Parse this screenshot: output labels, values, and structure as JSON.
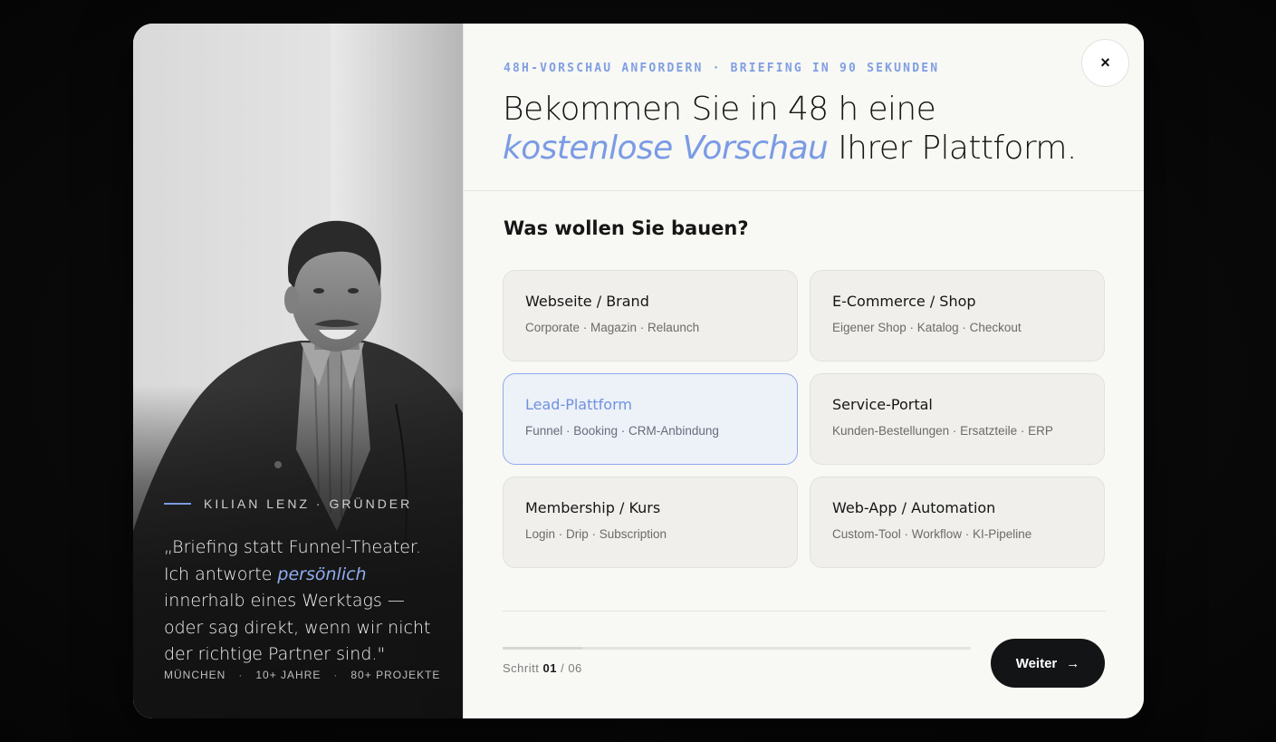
{
  "intro": {
    "eyebrow": "48H-VORSCHAU ANFORDERN · BRIEFING IN 90 SEKUNDEN",
    "headline_before": "Bekommen Sie in 48 h eine ",
    "headline_emph": "kostenlose Vorschau",
    "headline_after": " Ihrer Plattform."
  },
  "close": {
    "label": "×",
    "icon": "close-icon"
  },
  "founder": {
    "name_line": "KILIAN LENZ · GRÜNDER",
    "quote_before": "„Briefing statt Funnel-Theater. Ich antworte ",
    "quote_emph": "persönlich",
    "quote_after": " innerhalb eines Werktags — oder sag direkt, wenn wir nicht der richtige Partner sind.\"",
    "stats": [
      "MÜNCHEN",
      "10+ JAHRE",
      "80+ PROJEKTE"
    ],
    "stat_separator": "·"
  },
  "question": "Was wollen Sie bauen?",
  "options": [
    {
      "title": "Webseite / Brand",
      "subtitle": "Corporate · Magazin · Relaunch"
    },
    {
      "title": "E-Commerce / Shop",
      "subtitle": "Eigener Shop · Katalog · Checkout"
    },
    {
      "title": "Lead-Plattform",
      "subtitle": "Funnel · Booking · CRM-Anbindung"
    },
    {
      "title": "Service-Portal",
      "subtitle": "Kunden-Bestellungen · Ersatzteile · ERP"
    },
    {
      "title": "Membership / Kurs",
      "subtitle": "Login · Drip · Subscription"
    },
    {
      "title": "Web-App / Automation",
      "subtitle": "Custom-Tool · Workflow · KI-Pipeline"
    }
  ],
  "selected_option": "Lead-Plattform",
  "footer": {
    "step_label": "Schritt",
    "step_current": "01",
    "step_separator": "/",
    "step_total": "06",
    "progress_fraction": 0.17,
    "next_label": "Weiter",
    "next_icon": "→"
  },
  "colors": {
    "accent": "#7a9be5",
    "button_dark": "#121415",
    "panel_bg": "#f8f8f4"
  }
}
